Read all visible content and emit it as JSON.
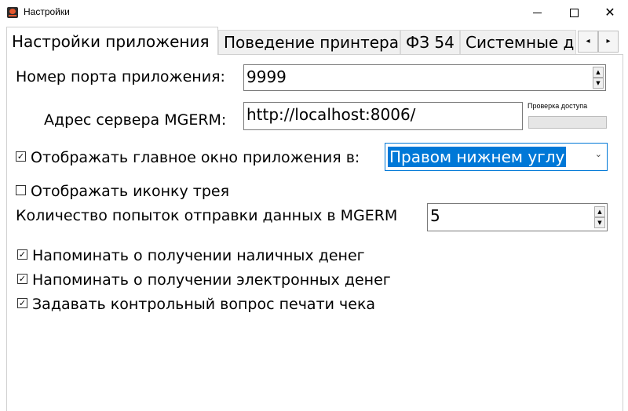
{
  "window": {
    "title": "Настройки",
    "minimize": "—",
    "maximize": "☐",
    "close": "✕"
  },
  "tabs": [
    {
      "label": "Настройки приложения"
    },
    {
      "label": "Поведение принтера"
    },
    {
      "label": "ФЗ 54"
    },
    {
      "label": "Системные д"
    }
  ],
  "tab_scroll": {
    "left": "◂",
    "right": "▸"
  },
  "port": {
    "label": "Номер порта приложения:",
    "value": "9999"
  },
  "server": {
    "label": "Адрес сервера MGERM:",
    "value": "http://localhost:8006/",
    "check_label": "Проверка доступа"
  },
  "show_window": {
    "checked": true,
    "label": "Отображать главное окно приложения в:",
    "selected": "Правом нижнем углу"
  },
  "tray_icon": {
    "checked": false,
    "label": "Отображать иконку трея"
  },
  "attempts": {
    "label": "Количество попыток отправки данных в MGERM",
    "value": "5"
  },
  "checkboxes": [
    {
      "checked": true,
      "label": "Напоминать о получении наличных денег"
    },
    {
      "checked": true,
      "label": "Напоминать о получении электронных денег"
    },
    {
      "checked": true,
      "label": "Задавать контрольный вопрос печати чека"
    }
  ],
  "check_glyph": "✓",
  "spin": {
    "up": "▲",
    "down": "▼"
  },
  "combo_arrow": "⌄"
}
